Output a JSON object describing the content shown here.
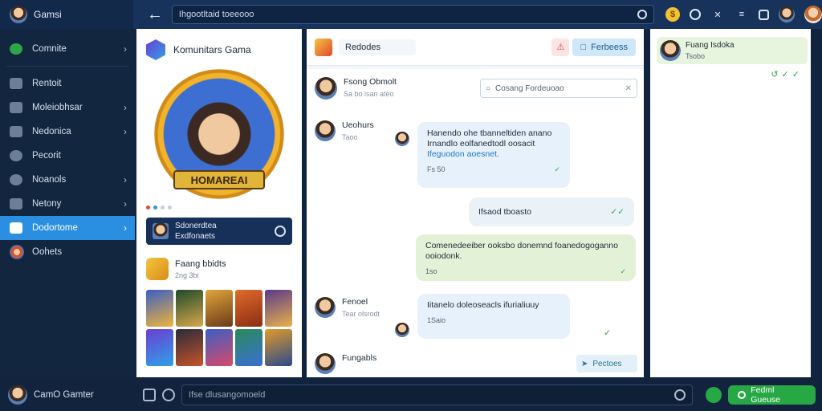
{
  "app": {
    "title": "Gamsi",
    "search_text": "Ihgootltaid toeeooo"
  },
  "sidebar": {
    "items": [
      {
        "label": "Comnite",
        "chevron": true
      },
      {
        "label": "Rentoit",
        "chevron": false
      },
      {
        "label": "Moleiobhsar",
        "chevron": true
      },
      {
        "label": "Nedonica",
        "chevron": true
      },
      {
        "label": "Pecorit",
        "chevron": false
      },
      {
        "label": "Noanols",
        "chevron": true
      },
      {
        "label": "Netony",
        "chevron": true
      },
      {
        "label": "Dodortome",
        "chevron": true,
        "active": true
      },
      {
        "label": "Oohets",
        "chevron": false
      }
    ],
    "footer_user": "CamO Gamter"
  },
  "community": {
    "name": "Komunitars Gama",
    "badge_text": "HOMAREAI",
    "member_line1": "Sdonerdtea",
    "member_line2": "Exdfonaets",
    "rank_title": "Faang bbidts",
    "rank_sub": "2ng 3bi"
  },
  "chat": {
    "header_label": "Redodes",
    "header_button": "Ferbeess",
    "sender1_name": "Fsong Obmolt",
    "sender1_sub": "Sa bo isan ateo",
    "search_placeholder": "Cosang Fordeuoao",
    "sender2_name": "Ueohurs",
    "sender2_sub": "Taoo",
    "msg1_line1": "Hanendo ohe tbanneltiden anano",
    "msg1_line2": "Irnandlo eolfanedtodl oosacit",
    "msg1_link": "Ifeguodon aoesnet.",
    "msg1_meta": "Fs 50",
    "msg2_text": "Ifsaod tboasto",
    "msg3_text": "Comenedeeiber ooksbo donemnd foanedogoganno ooiodonk.",
    "msg3_meta": "1so",
    "sender3_name": "Fenoel",
    "sender3_sub": "Tear olsrodt",
    "msg4_text": "Iitanelo doleoseacls ifurialiuuy",
    "msg4_meta": "1Saio",
    "sender4_name": "Fungabls",
    "reply_label": "Pectoes"
  },
  "right": {
    "card_title": "Fuang Isdoka",
    "card_sub": "Tsobo"
  },
  "composer": {
    "placeholder": "Ifse dlusangomoeld",
    "send_label": "Fedml Gueuse"
  },
  "colors": {
    "accent": "#2a8fe0",
    "topbar": "#17335c",
    "sidebar": "#13263f",
    "send": "#27a845"
  }
}
